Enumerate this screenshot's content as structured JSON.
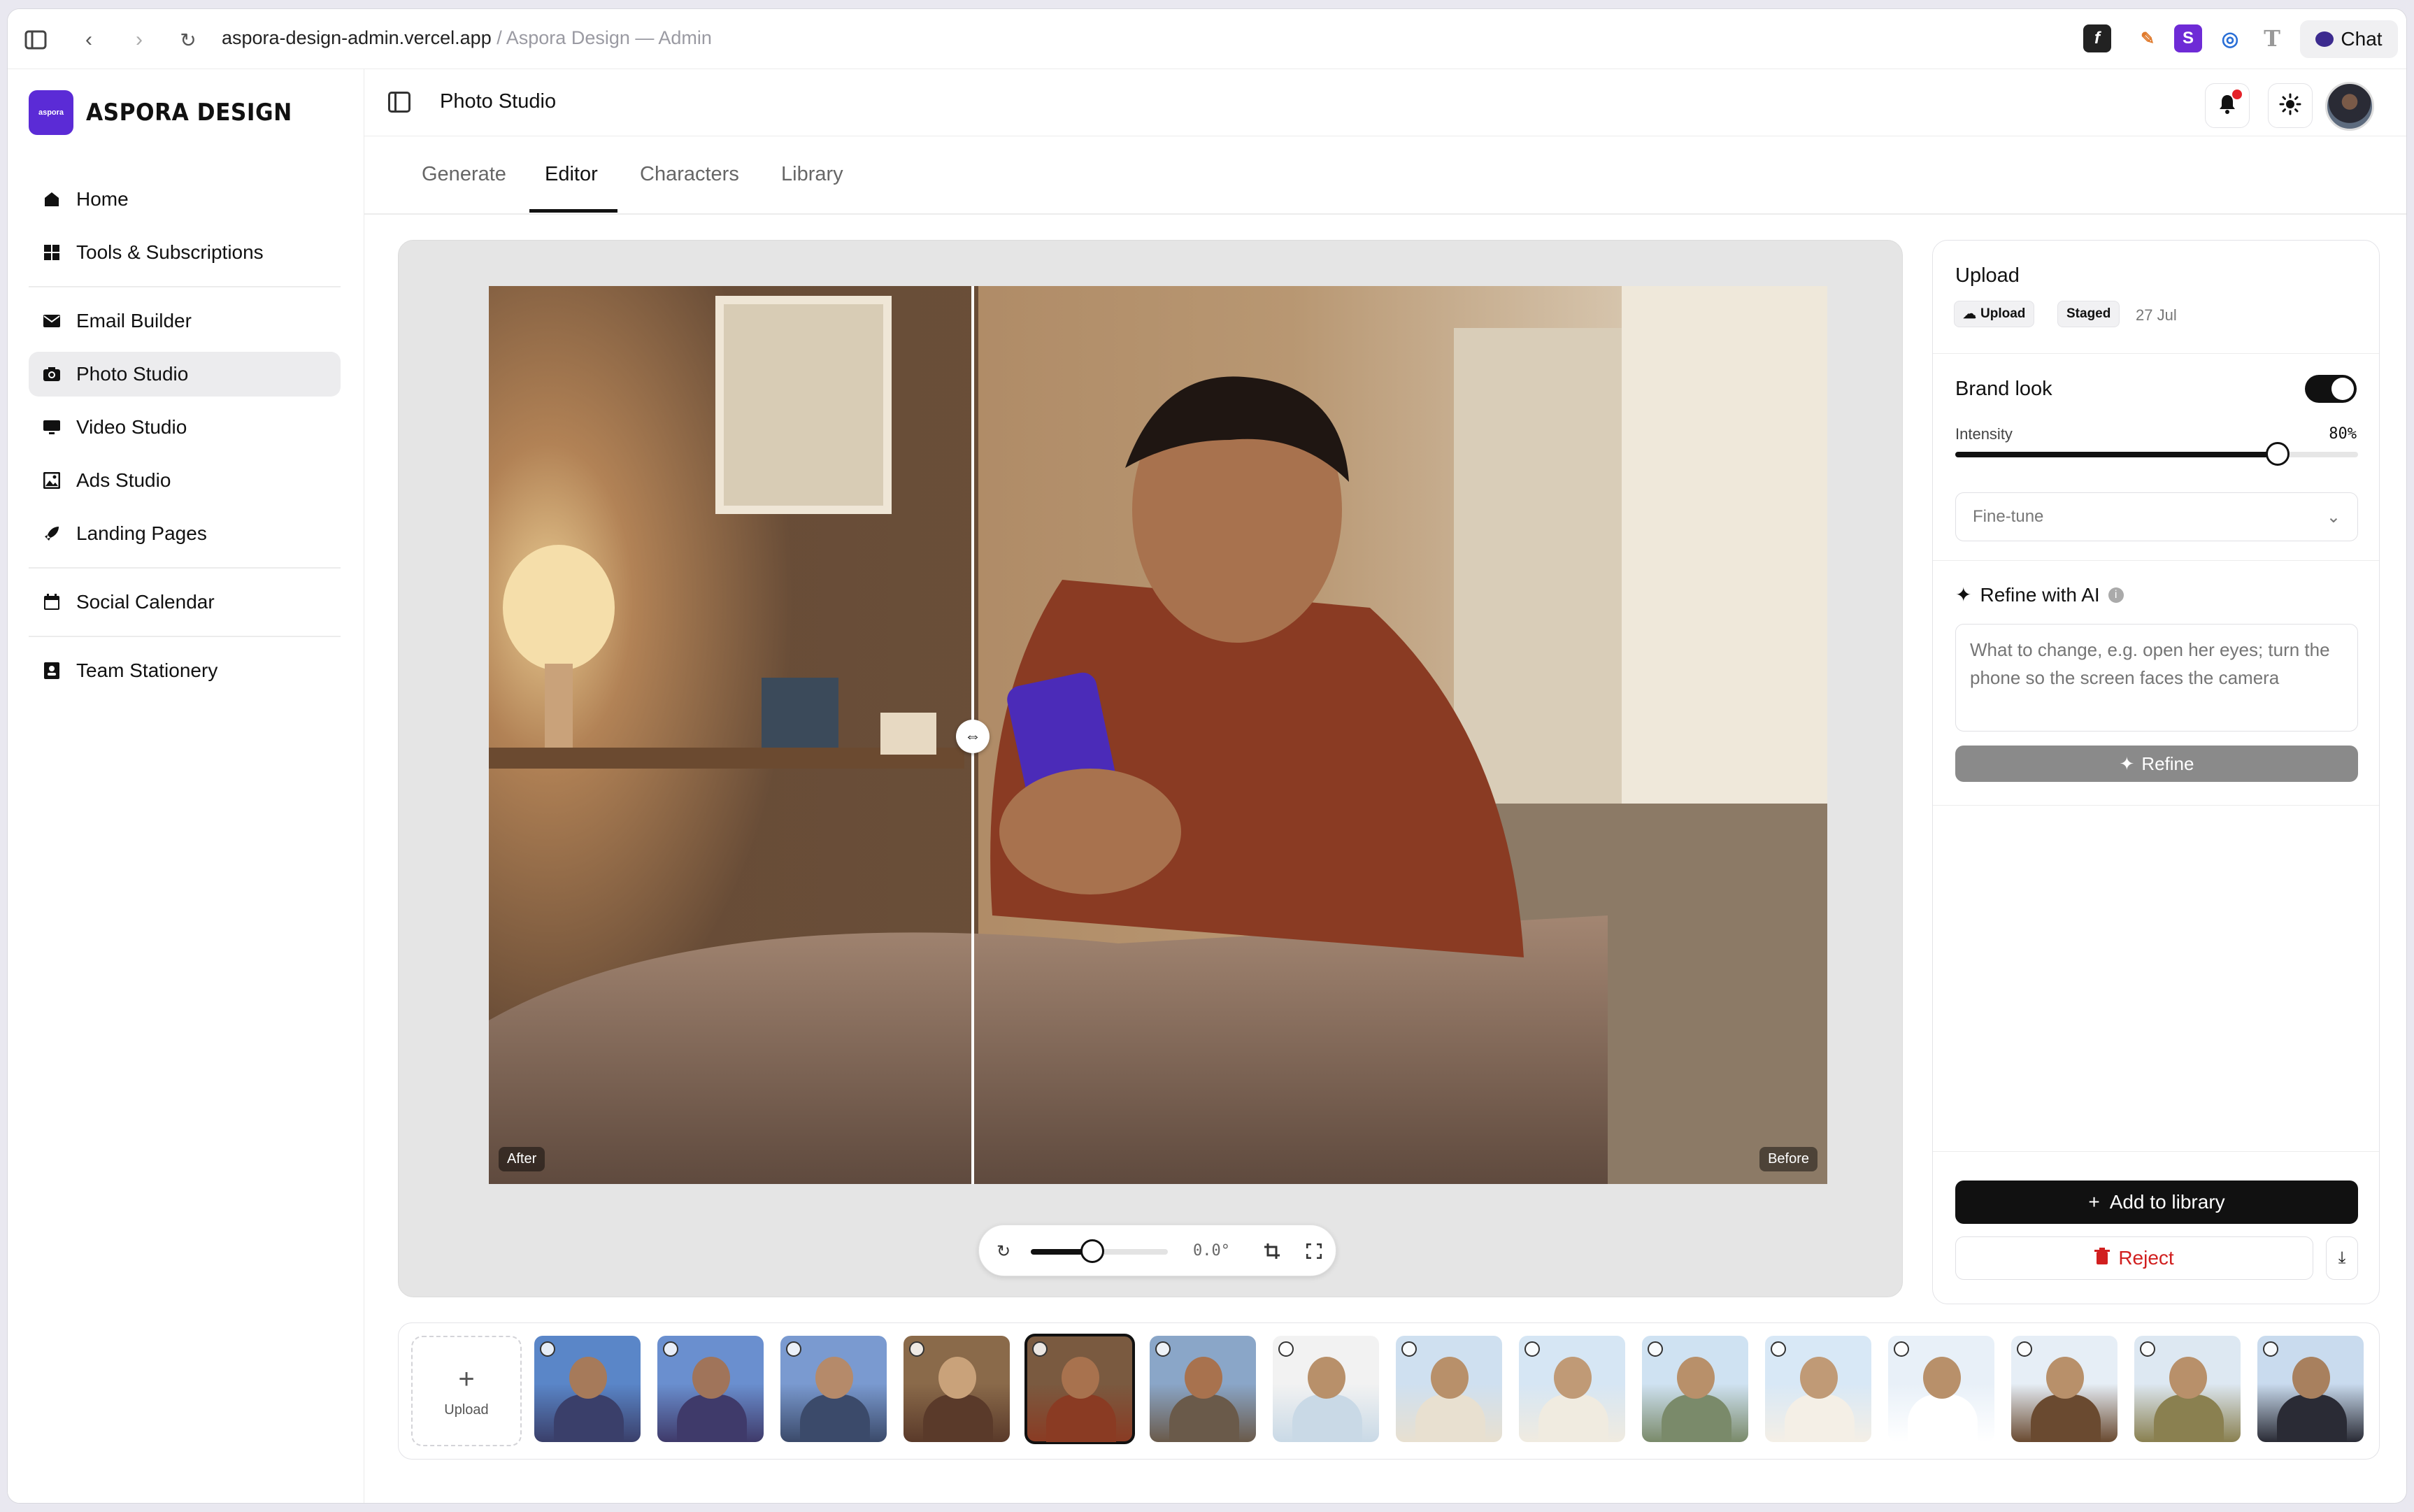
{
  "browser": {
    "url": "aspora-design-admin.vercel.app",
    "separator": "/",
    "page_title": "Aspora Design — Admin",
    "chat_label": "Chat"
  },
  "brand": {
    "mark": "aspora",
    "name": "ASPORA DESIGN"
  },
  "sidebar": {
    "items": [
      {
        "label": "Home",
        "icon": "home-icon"
      },
      {
        "label": "Tools & Subscriptions",
        "icon": "grid-icon"
      },
      {
        "label": "Email Builder",
        "icon": "mail-icon"
      },
      {
        "label": "Photo Studio",
        "icon": "camera-icon",
        "active": true
      },
      {
        "label": "Video Studio",
        "icon": "monitor-icon"
      },
      {
        "label": "Ads Studio",
        "icon": "image-icon"
      },
      {
        "label": "Landing Pages",
        "icon": "rocket-icon"
      },
      {
        "label": "Social Calendar",
        "icon": "calendar-icon"
      },
      {
        "label": "Team Stationery",
        "icon": "contact-card-icon"
      }
    ]
  },
  "header": {
    "title": "Photo Studio"
  },
  "tabs": [
    {
      "label": "Generate"
    },
    {
      "label": "Editor",
      "active": true
    },
    {
      "label": "Characters"
    },
    {
      "label": "Library"
    }
  ],
  "editor": {
    "after_label": "After",
    "before_label": "Before",
    "rotation_value": "0.0°",
    "zoom_level": 0.45
  },
  "panel": {
    "upload": {
      "title": "Upload",
      "source_chip": "Upload",
      "status_chip": "Staged",
      "date": "27 Jul"
    },
    "brand_look": {
      "title": "Brand look",
      "enabled": true,
      "intensity_label": "Intensity",
      "intensity_value": "80%",
      "intensity": 0.8,
      "fine_tune_placeholder": "Fine-tune"
    },
    "refine": {
      "title": "Refine with AI",
      "placeholder": "What to change, e.g. open her eyes; turn the phone so the screen faces the camera",
      "button_label": "Refine"
    },
    "add_to_library_label": "Add to library",
    "reject_label": "Reject"
  },
  "filmstrip": {
    "upload_label": "Upload",
    "selected_index": 4,
    "thumbnails": 15
  },
  "colors": {
    "brand": "#5b2bd6",
    "accent": "#111111",
    "danger": "#d11f1f",
    "notification": "#e5232a"
  }
}
